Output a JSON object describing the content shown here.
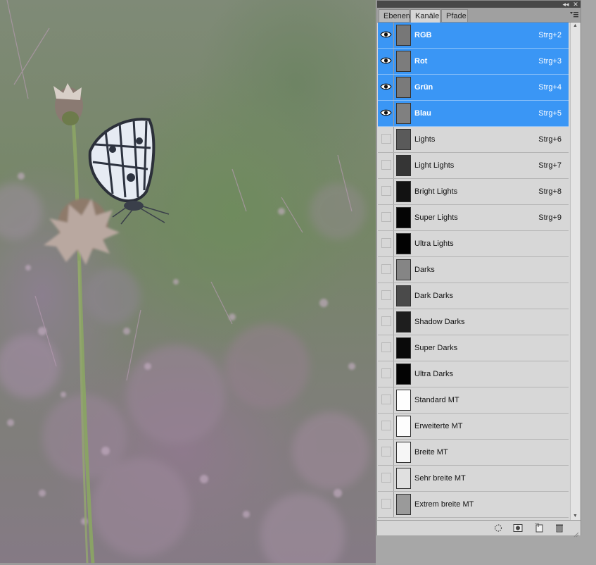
{
  "panel": {
    "collapse_icon": "double-chevron-left-icon",
    "close_icon": "close-icon",
    "tabs": [
      {
        "label": "Ebenen",
        "active": false
      },
      {
        "label": "Kanäle",
        "active": true
      },
      {
        "label": "Pfade",
        "active": false
      }
    ],
    "menu_icon": "panel-menu-icon"
  },
  "channels": [
    {
      "name": "RGB",
      "shortcut": "Strg+2",
      "selected": true,
      "visible": true,
      "thumb": "#777777"
    },
    {
      "name": "Rot",
      "shortcut": "Strg+3",
      "selected": true,
      "visible": true,
      "thumb": "#7c7c7c"
    },
    {
      "name": "Grün",
      "shortcut": "Strg+4",
      "selected": true,
      "visible": true,
      "thumb": "#7a7a7a"
    },
    {
      "name": "Blau",
      "shortcut": "Strg+5",
      "selected": true,
      "visible": true,
      "thumb": "#808080"
    },
    {
      "name": "Lights",
      "shortcut": "Strg+6",
      "selected": false,
      "visible": false,
      "thumb": "#5a5a5a"
    },
    {
      "name": "Light Lights",
      "shortcut": "Strg+7",
      "selected": false,
      "visible": false,
      "thumb": "#353535"
    },
    {
      "name": "Bright Lights",
      "shortcut": "Strg+8",
      "selected": false,
      "visible": false,
      "thumb": "#121212"
    },
    {
      "name": "Super Lights",
      "shortcut": "Strg+9",
      "selected": false,
      "visible": false,
      "thumb": "#050505"
    },
    {
      "name": "Ultra Lights",
      "shortcut": "",
      "selected": false,
      "visible": false,
      "thumb": "#020202"
    },
    {
      "name": "Darks",
      "shortcut": "",
      "selected": false,
      "visible": false,
      "thumb": "#858585"
    },
    {
      "name": "Dark Darks",
      "shortcut": "",
      "selected": false,
      "visible": false,
      "thumb": "#4a4a4a"
    },
    {
      "name": "Shadow Darks",
      "shortcut": "",
      "selected": false,
      "visible": false,
      "thumb": "#1e1e1e"
    },
    {
      "name": "Super Darks",
      "shortcut": "",
      "selected": false,
      "visible": false,
      "thumb": "#0a0a0a"
    },
    {
      "name": "Ultra Darks",
      "shortcut": "",
      "selected": false,
      "visible": false,
      "thumb": "#030303"
    },
    {
      "name": "Standard MT",
      "shortcut": "",
      "selected": false,
      "visible": false,
      "thumb": "#fefefe"
    },
    {
      "name": "Erweiterte MT",
      "shortcut": "",
      "selected": false,
      "visible": false,
      "thumb": "#fdfdfd"
    },
    {
      "name": "Breite MT",
      "shortcut": "",
      "selected": false,
      "visible": false,
      "thumb": "#f6f6f6"
    },
    {
      "name": "Sehr breite MT",
      "shortcut": "",
      "selected": false,
      "visible": false,
      "thumb": "#e0e0e0"
    },
    {
      "name": "Extrem breite MT",
      "shortcut": "",
      "selected": false,
      "visible": false,
      "thumb": "#9a9a9a"
    }
  ],
  "footer": {
    "buttons": [
      "load-selection-icon",
      "save-selection-icon",
      "new-channel-icon",
      "delete-channel-icon"
    ]
  },
  "colors": {
    "selection": "#3a96f5",
    "panel_bg": "#d6d6d6",
    "tab_strip": "#a0a0a0"
  }
}
